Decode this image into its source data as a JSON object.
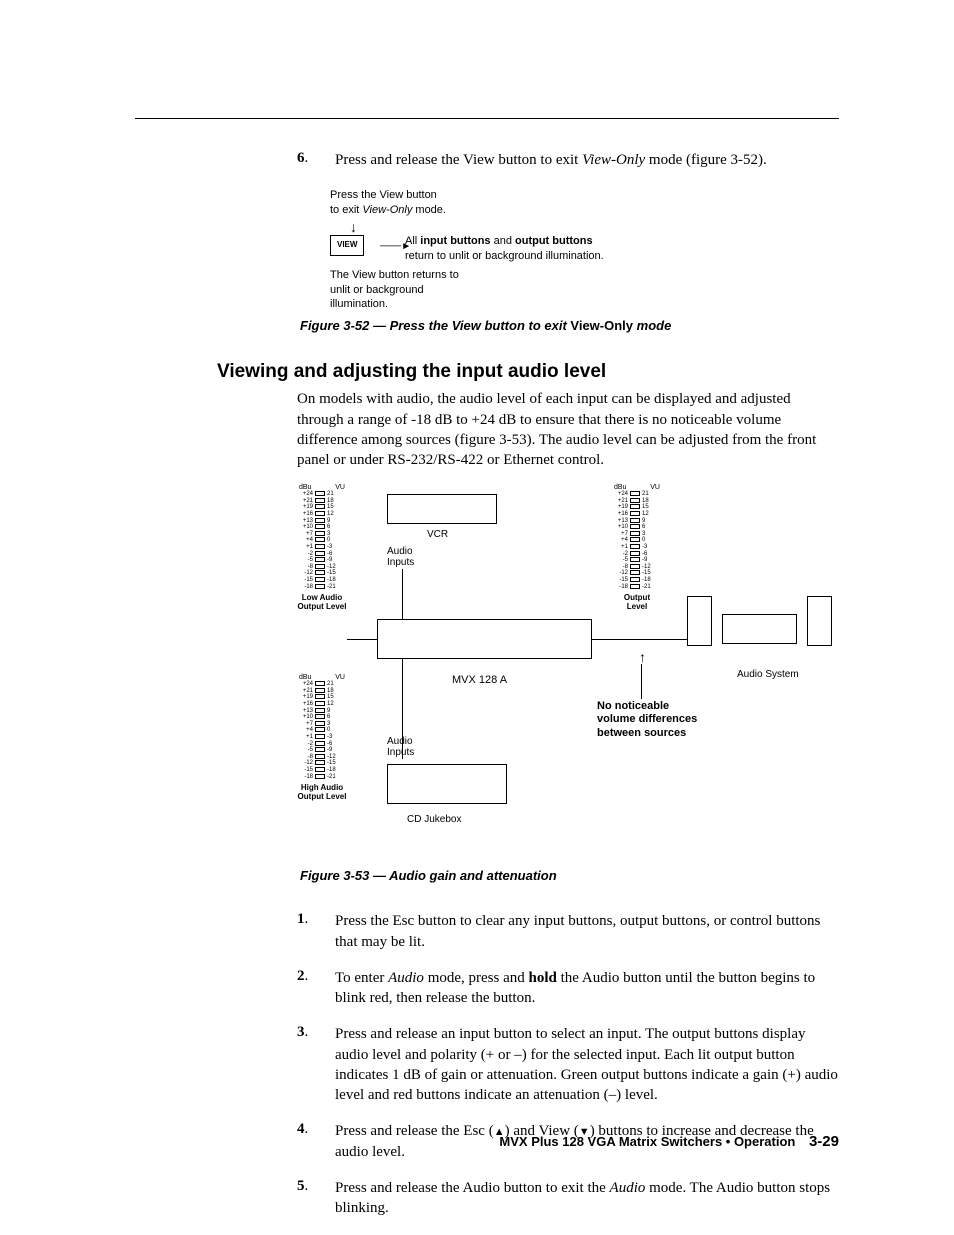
{
  "step6": {
    "num": "6",
    "text_parts": [
      "Press and release the View button to exit ",
      "View-Only",
      " mode (figure 3-52)."
    ]
  },
  "figure52": {
    "row1": [
      "Press the View button",
      "to exit ",
      "View-Only",
      " mode."
    ],
    "button_label": "VIEW",
    "arrow_text": [
      "All ",
      "input buttons",
      " and ",
      "output buttons",
      "return to unlit or background illumination."
    ],
    "row3": [
      "The View button returns to",
      "unlit or background",
      "illumination."
    ],
    "caption_parts": [
      "Figure 3-52 — Press the View button to exit ",
      "View-Only",
      " mode"
    ]
  },
  "section_heading": "Viewing and adjusting the input audio level",
  "intro_para": "On models with audio, the audio level of each input can be displayed and adjusted through a range of -18 dB to +24 dB to ensure that there is no noticeable volume difference among sources (figure 3-53).  The audio level can be adjusted from the front panel or under RS-232/RS-422 or Ethernet control.",
  "figure53": {
    "meter_headers": [
      "dBu",
      "VU"
    ],
    "meter_rows": [
      [
        "+24",
        "21"
      ],
      [
        "+21",
        "18"
      ],
      [
        "+19",
        "15"
      ],
      [
        "+16",
        "12"
      ],
      [
        "+13",
        "9"
      ],
      [
        "+10",
        "6"
      ],
      [
        "+7",
        "3"
      ],
      [
        "+4",
        "0"
      ],
      [
        "+1",
        "-3"
      ],
      [
        "-2",
        "-6"
      ],
      [
        "-5",
        "-9"
      ],
      [
        "-8",
        "-12"
      ],
      [
        "-12",
        "-15"
      ],
      [
        "-15",
        "-18"
      ],
      [
        "-18",
        "-21"
      ]
    ],
    "low_label": [
      "Low Audio",
      "Output Level"
    ],
    "high_label": [
      "High Audio",
      "Output Level"
    ],
    "output_label": [
      "Output",
      "Level"
    ],
    "audio_inputs": "Audio\nInputs",
    "vcr_label": "VCR",
    "cd_label": "CD Jukebox",
    "mvx_label": "MVX 128 A",
    "audio_system": "Audio System",
    "callout": [
      "No noticeable",
      "volume differences",
      "between sources"
    ],
    "caption": "Figure 3-53 — Audio gain and attenuation"
  },
  "steps": [
    {
      "num": "1",
      "text": "Press the Esc button to clear any input buttons, output buttons, or control buttons that may be lit."
    },
    {
      "num": "2",
      "text_parts": [
        "To enter ",
        "Audio",
        " mode, press and ",
        "hold",
        " the Audio button until the button begins to blink red, then release the button."
      ]
    },
    {
      "num": "3",
      "text": "Press and release an input button to select an input.  The output buttons display audio level and polarity (+ or –) for the selected input.  Each lit output button indicates 1 dB of gain or attenuation.  Green output buttons indicate a gain (+) audio level and red buttons indicate an attenuation (–) level."
    },
    {
      "num": "4",
      "text_parts": [
        "Press and release the Esc (",
        "▲",
        ") and View (",
        "▼",
        ") buttons to increase and decrease the audio level."
      ]
    },
    {
      "num": "5",
      "text_parts": [
        "Press and release the Audio button to exit the ",
        "Audio",
        " mode.  The Audio button stops blinking."
      ]
    }
  ],
  "footer": {
    "text": "MVX Plus 128 VGA Matrix Switchers • Operation",
    "page": "3-29"
  }
}
